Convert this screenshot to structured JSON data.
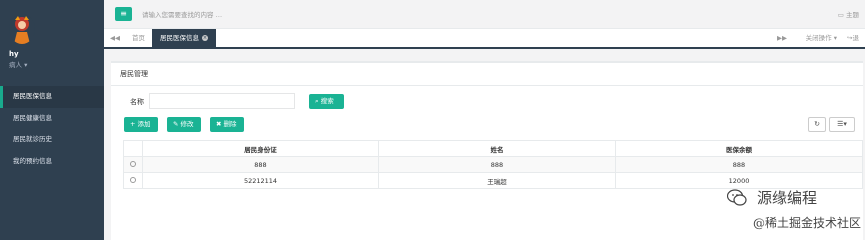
{
  "user": {
    "name": "hy",
    "role": "病人 ▾"
  },
  "sidebar": {
    "items": [
      {
        "label": "居民医保信息",
        "active": true
      },
      {
        "label": "居民健康信息",
        "active": false
      },
      {
        "label": "居民就诊历史",
        "active": false
      },
      {
        "label": "我的预约信息",
        "active": false
      }
    ]
  },
  "topbar": {
    "search_placeholder": "请输入您需要查找的内容 …",
    "theme": "主题"
  },
  "tabs": {
    "prev": "◀◀",
    "home": "首页",
    "active": "居民医保信息",
    "next": "▶▶",
    "close_ops": "关闭操作 ▾",
    "refresh": "退"
  },
  "card": {
    "title": "居民管理"
  },
  "search": {
    "label": "名称",
    "value": "",
    "button": "搜索"
  },
  "toolbar": {
    "add": "添加",
    "edit": "修改",
    "delete": "删除"
  },
  "table": {
    "headers": [
      "居民身份证",
      "姓名",
      "医保余额"
    ],
    "rows": [
      [
        "888",
        "888",
        "888"
      ],
      [
        "52212114",
        "王瑞超",
        "12000"
      ]
    ]
  },
  "watermark": {
    "brand": "源缘编程",
    "sub": "@稀土掘金技术社区"
  }
}
